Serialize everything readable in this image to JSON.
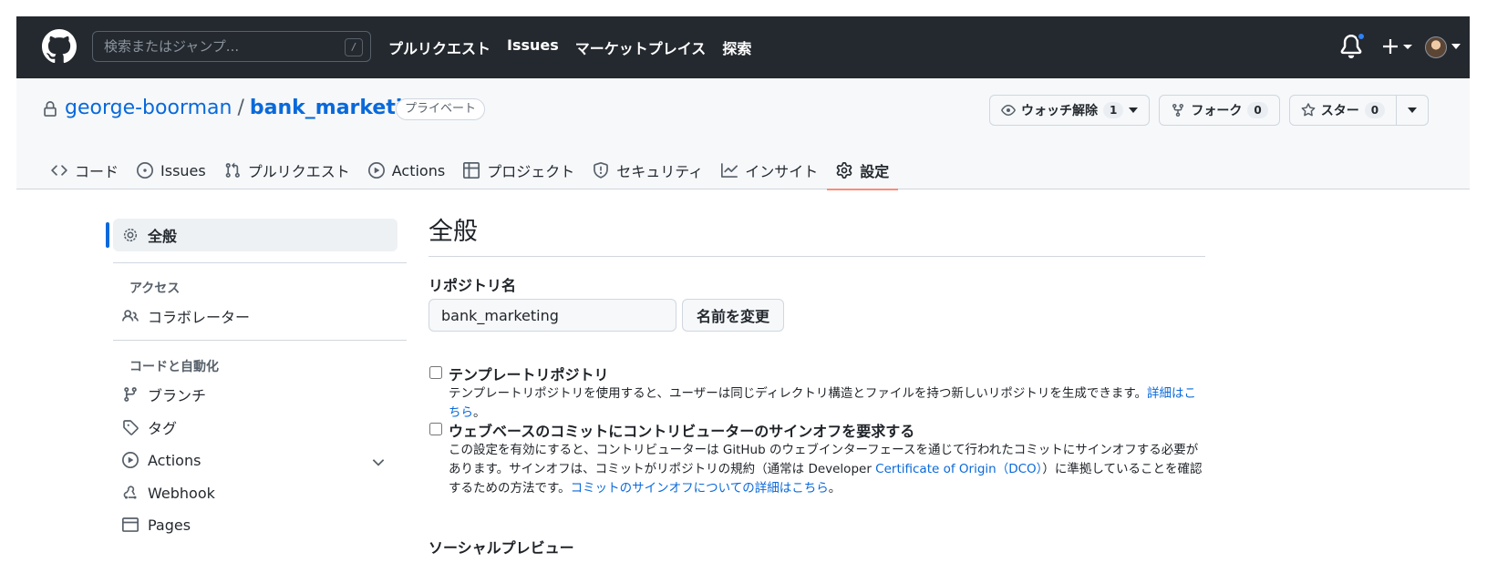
{
  "header": {
    "search_placeholder": "検索またはジャンプ...",
    "search_shortcut": "/",
    "nav": [
      "プルリクエスト",
      "Issues",
      "マーケットプレイス",
      "探索"
    ]
  },
  "repo": {
    "owner": "george-boorman",
    "separator": "/",
    "name": "bank_marketing",
    "visibility": "プライベート",
    "watch_label": "ウォッチ解除",
    "watch_count": "1",
    "fork_label": "フォーク",
    "fork_count": "0",
    "star_label": "スター",
    "star_count": "0"
  },
  "tabs": [
    {
      "label": "コード",
      "icon": "code-icon"
    },
    {
      "label": "Issues",
      "icon": "issue-icon"
    },
    {
      "label": "プルリクエスト",
      "icon": "pull-request-icon"
    },
    {
      "label": "Actions",
      "icon": "play-icon"
    },
    {
      "label": "プロジェクト",
      "icon": "table-icon"
    },
    {
      "label": "セキュリティ",
      "icon": "shield-icon"
    },
    {
      "label": "インサイト",
      "icon": "graph-icon"
    },
    {
      "label": "設定",
      "icon": "gear-icon",
      "active": true
    }
  ],
  "sidebar": {
    "general": "全般",
    "access_heading": "アクセス",
    "collaborators": "コラボレーター",
    "code_heading": "コードと自動化",
    "branches": "ブランチ",
    "tags": "タグ",
    "actions": "Actions",
    "webhook": "Webhook",
    "pages": "Pages"
  },
  "main": {
    "title": "全般",
    "repo_name_label": "リポジトリ名",
    "repo_name_value": "bank_marketing",
    "rename_button": "名前を変更",
    "template_title": "テンプレートリポジトリ",
    "template_desc": "テンプレートリポジトリを使用すると、ユーザーは同じディレクトリ構造とファイルを持つ新しいリポジトリを生成できます。",
    "template_link": "詳細はこちら",
    "template_end": "。",
    "signoff_title": "ウェブベースのコミットにコントリビューターのサインオフを要求する",
    "signoff_desc_1": "この設定を有効にすると、コントリビューターは GitHub のウェブインターフェースを通じて行われたコミットにサインオフする必要が",
    "signoff_desc_2a": "あります。サインオフは、コミットがリポジトリの規約（通常は Developer ",
    "signoff_link_1": "Certificate of Origin（DCO）",
    "signoff_desc_2b": "）に準拠していることを確認",
    "signoff_desc_3a": "するための方法です。",
    "signoff_link_2": "コミットのサインオフについての詳細はこちら",
    "signoff_end": "。",
    "social_preview_title": "ソーシャルプレビュー"
  }
}
